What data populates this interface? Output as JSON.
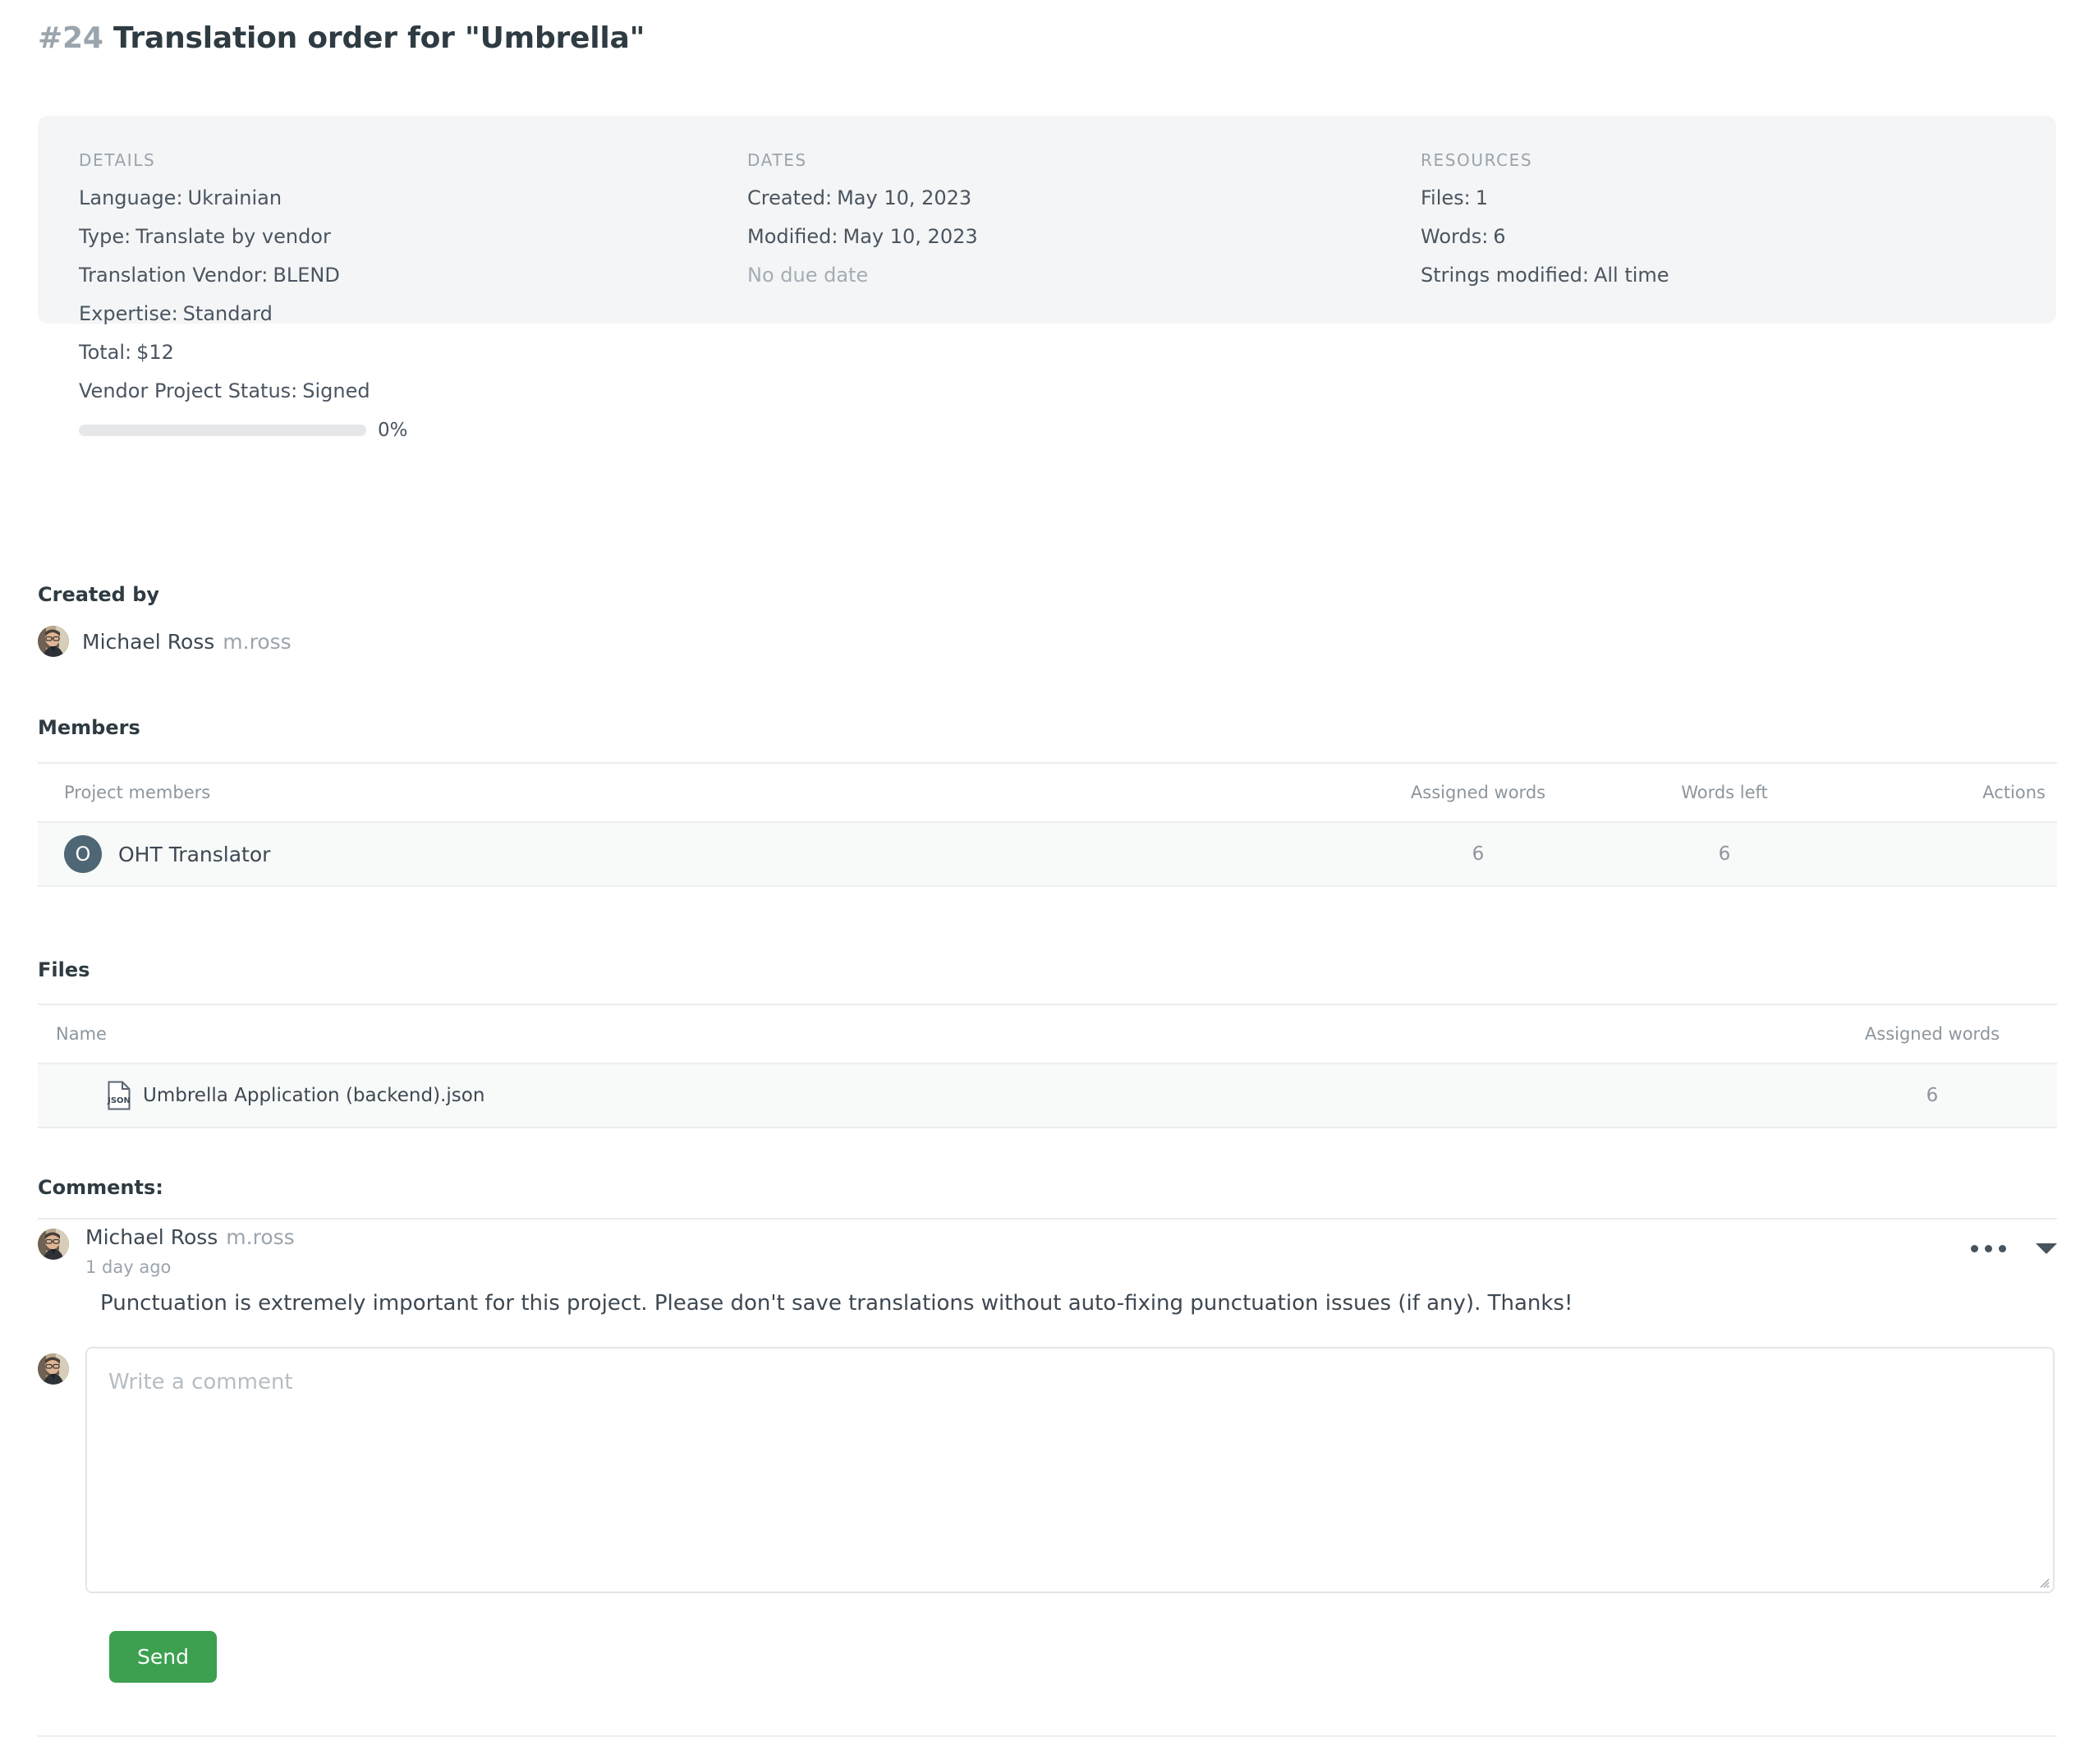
{
  "header": {
    "order_number": "#24",
    "title": "Translation order for \"Umbrella\""
  },
  "info_panel": {
    "details": {
      "heading": "DETAILS",
      "rows": [
        {
          "key": "Language:",
          "value": "Ukrainian"
        },
        {
          "key": "Type:",
          "value": "Translate by vendor"
        },
        {
          "key": "Translation Vendor:",
          "value": "BLEND"
        },
        {
          "key": "Expertise:",
          "value": "Standard"
        },
        {
          "key": "Total:",
          "value": "$12"
        },
        {
          "key": "Vendor Project Status:",
          "value": "Signed"
        }
      ],
      "progress_percent_label": "0%",
      "progress_value": 0
    },
    "dates": {
      "heading": "DATES",
      "rows": [
        {
          "key": "Created:",
          "value": "May 10, 2023"
        },
        {
          "key": "Modified:",
          "value": "May 10, 2023"
        }
      ],
      "no_due_date": "No due date"
    },
    "resources": {
      "heading": "RESOURCES",
      "rows": [
        {
          "key": "Files:",
          "value": "1"
        },
        {
          "key": "Words:",
          "value": "6"
        },
        {
          "key": "Strings modified:",
          "value": "All time"
        }
      ]
    }
  },
  "created_by": {
    "label": "Created by",
    "user_name": "Michael Ross",
    "user_handle": "m.ross",
    "avatar": "user-photo-avatar"
  },
  "members": {
    "label": "Members",
    "columns": [
      "Project members",
      "Assigned words",
      "Words left",
      "Actions"
    ],
    "rows": [
      {
        "initial": "O",
        "name": "OHT Translator",
        "assigned_words": "6",
        "words_left": "6",
        "actions": ""
      }
    ],
    "avatar_color": "#4f6774"
  },
  "files": {
    "label": "Files",
    "columns": [
      "Name",
      "Assigned words"
    ],
    "rows": [
      {
        "icon": "json-file-icon",
        "name": "Umbrella Application (backend).json",
        "assigned_words": "6"
      }
    ]
  },
  "comments": {
    "label": "Comments:",
    "items": [
      {
        "user_name": "Michael Ross",
        "user_handle": "m.ross",
        "time": "1 day ago",
        "text": "Punctuation is extremely important for this project. Please don't save translations without auto-fixing punctuation issues (if any). Thanks!",
        "more_icon": "ellipsis-icon",
        "collapse_icon": "chevron-down-icon"
      }
    ],
    "composer": {
      "placeholder": "Write a comment",
      "value": "",
      "send_label": "Send",
      "send_color": "#3ca050"
    }
  }
}
